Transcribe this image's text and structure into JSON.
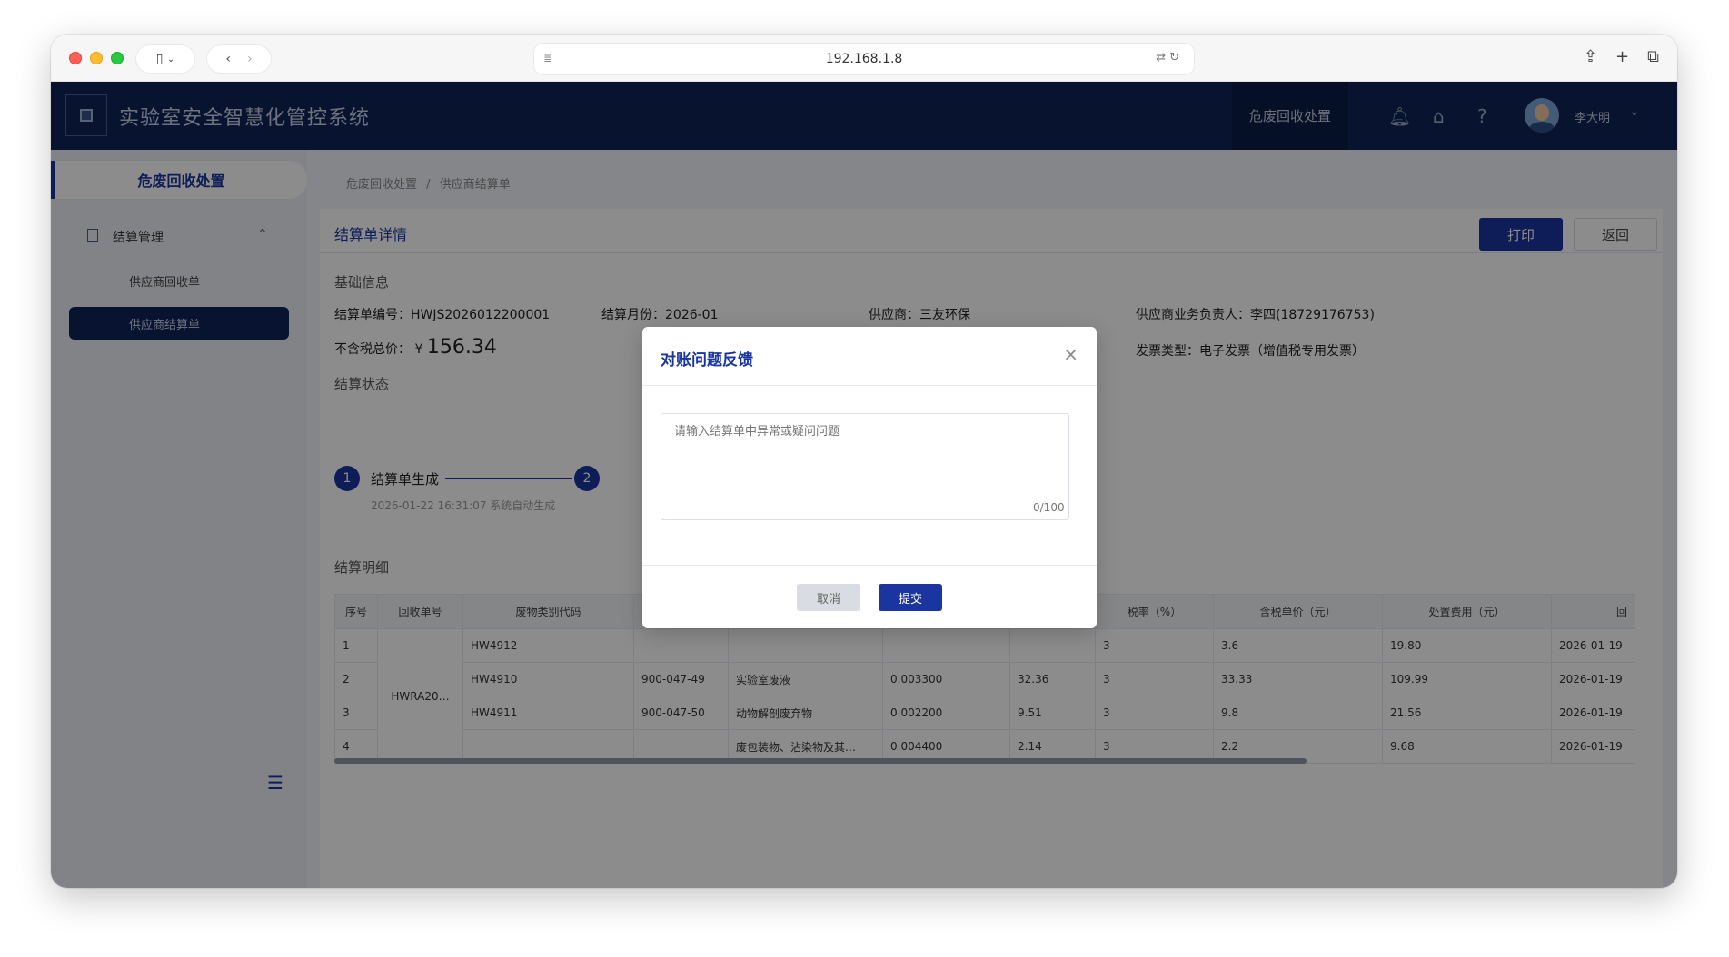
{
  "browser": {
    "url": "192.168.1.8"
  },
  "header": {
    "title": "实验室安全智慧化管控系统",
    "active_tab": "危废回收处置",
    "user_name": "李大明"
  },
  "sidebar": {
    "section": "危废回收处置",
    "group_label": "结算管理",
    "items": [
      {
        "label": "供应商回收单"
      },
      {
        "label": "供应商结算单"
      }
    ]
  },
  "breadcrumb": {
    "items": [
      "危废回收处置",
      "/",
      "供应商结算单"
    ]
  },
  "panel": {
    "title": "结算单详情",
    "print_label": "打印",
    "back_label": "返回",
    "basic_info_label": "基础信息",
    "info": {
      "no_label": "结算单编号：",
      "no_value": "HWJS2026012200001",
      "month_label": "结算月份：",
      "month_value": "2026-01",
      "supplier_label": "供应商：",
      "supplier_value": "三友环保",
      "contact_label": "供应商业务负责人：",
      "contact_value": "李四(18729176753)",
      "price_label": "不含税总价：",
      "price_symbol": "¥",
      "price_value": "156.34",
      "invoice_label": "发票类型：",
      "invoice_value": "电子发票（增值税专用发票）"
    },
    "status_label": "结算状态",
    "steps": [
      {
        "num": "1",
        "label": "结算单生成",
        "time": "2026-01-22 16:31:07 系统自动生成"
      },
      {
        "num": "2",
        "label": ""
      }
    ],
    "detail_label": "结算明细",
    "table": {
      "headers": [
        "序号",
        "回收单号",
        "废物类别代码",
        "",
        "",
        "",
        "",
        "税率（%）",
        "含税单价（元）",
        "处置费用（元）",
        "回"
      ],
      "recycle_no": "HWRA20…",
      "rows": [
        [
          "1",
          "HW4912",
          "",
          "",
          "",
          "",
          "3",
          "3.6",
          "19.80",
          "2026-01-19"
        ],
        [
          "2",
          "HW4910",
          "900-047-49",
          "实验室废液",
          "0.003300",
          "32.36",
          "3",
          "33.33",
          "109.99",
          "2026-01-19"
        ],
        [
          "3",
          "HW4911",
          "900-047-50",
          "动物解剖废弃物",
          "0.002200",
          "9.51",
          "3",
          "9.8",
          "21.56",
          "2026-01-19"
        ],
        [
          "4",
          "",
          "",
          "废包装物、沾染物及其…",
          "0.004400",
          "2.14",
          "3",
          "2.2",
          "9.68",
          "2026-01-19"
        ]
      ]
    }
  },
  "dialog": {
    "title": "对账问题反馈",
    "placeholder": "请输入结算单中异常或疑问问题",
    "count": "0/100",
    "cancel_label": "取消",
    "submit_label": "提交"
  }
}
